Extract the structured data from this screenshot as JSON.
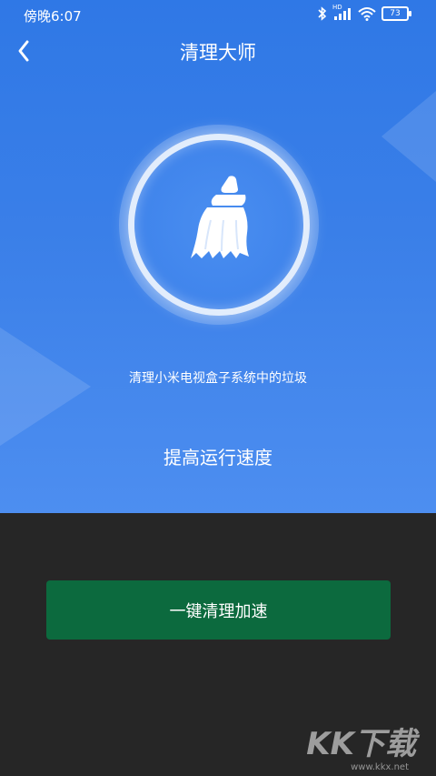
{
  "status_bar": {
    "time": "傍晚6:07",
    "battery": "73",
    "network": "HD"
  },
  "header": {
    "title": "清理大师"
  },
  "main": {
    "description": "清理小米电视盒子系统中的垃圾",
    "speed_text": "提高运行速度"
  },
  "action": {
    "button_label": "一键清理加速"
  },
  "watermark": {
    "logo": "KK下载",
    "url": "www.kkx.net"
  },
  "colors": {
    "header_blue": "#2f78e6",
    "bottom_dark": "#262626",
    "button_green": "#0c6a3e"
  }
}
